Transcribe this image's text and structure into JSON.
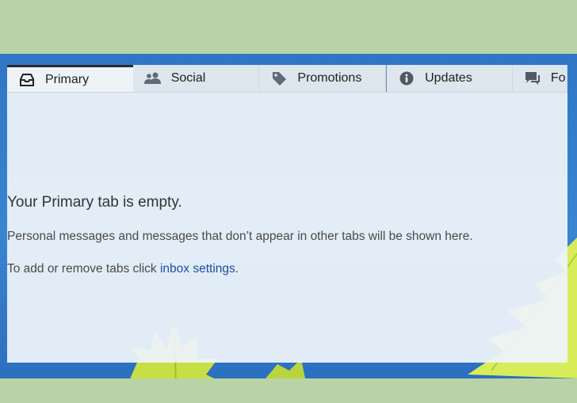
{
  "tabs": [
    {
      "label": "Primary",
      "icon": "inbox-tray-icon",
      "active": true
    },
    {
      "label": "Social",
      "icon": "people-icon",
      "active": false
    },
    {
      "label": "Promotions",
      "icon": "tag-icon",
      "active": false
    },
    {
      "label": "Updates",
      "icon": "info-icon",
      "active": false
    },
    {
      "label": "Fo",
      "icon": "forum-chat-icon",
      "active": false
    }
  ],
  "empty_state": {
    "title": "Your Primary tab is empty.",
    "description": "Personal messages and messages that don’t appear in other tabs will be shown here.",
    "settings_prefix": "To add or remove tabs click ",
    "settings_link": "inbox settings",
    "settings_suffix": "."
  },
  "colors": {
    "page_background": "#b9d3a6",
    "wallpaper_blue": "#2f76c4",
    "panel": "#edf3fa",
    "link": "#1b4f9c",
    "leaf": "#c4e03a"
  }
}
